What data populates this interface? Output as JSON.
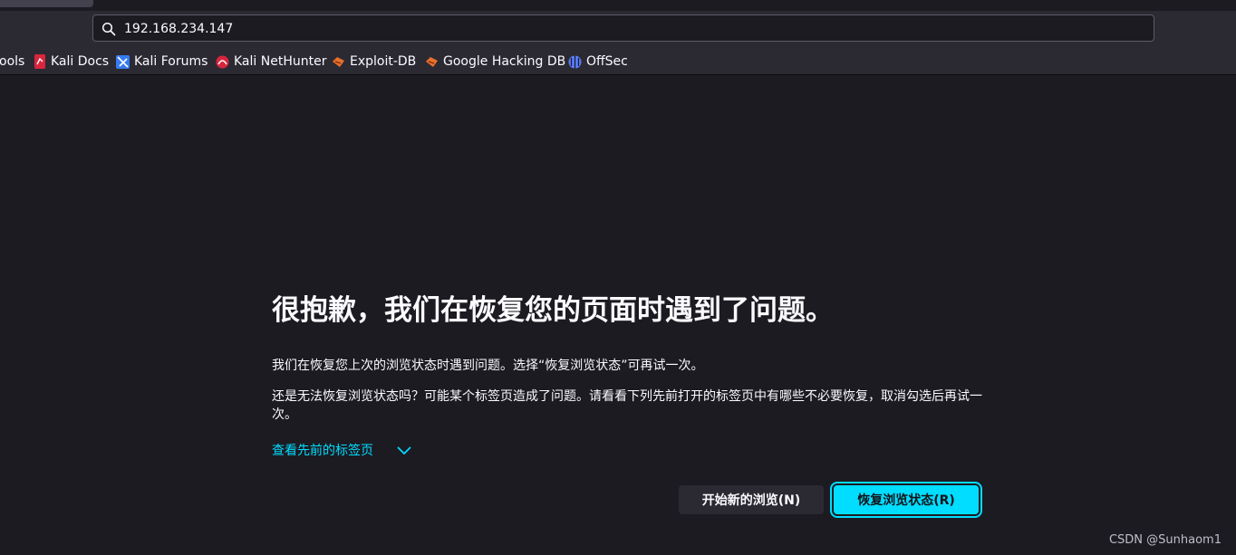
{
  "toolbar": {
    "url": "192.168.234.147"
  },
  "bookmarks": [
    {
      "label": "ools",
      "icon": "truncated-bookmark"
    },
    {
      "label": "Kali Docs",
      "icon": "kali-docs-icon",
      "color": "#d7263d"
    },
    {
      "label": "Kali Forums",
      "icon": "kali-forums-icon",
      "color": "#367bf0"
    },
    {
      "label": "Kali NetHunter",
      "icon": "kali-nethunter-icon",
      "color": "#d7263d"
    },
    {
      "label": "Exploit-DB",
      "icon": "exploit-db-icon",
      "color": "#e86f2c"
    },
    {
      "label": "Google Hacking DB",
      "icon": "ghdb-icon",
      "color": "#e86f2c"
    },
    {
      "label": "OffSec",
      "icon": "offsec-icon",
      "color": "#5b7fff"
    }
  ],
  "page": {
    "title": "很抱歉，我们在恢复您的页面时遇到了问题。",
    "message1": "我们在恢复您上次的浏览状态时遇到问题。选择“恢复浏览状态”可再试一次。",
    "message2": "还是无法恢复浏览状态吗？可能某个标签页造成了问题。请看看下列先前打开的标签页中有哪些不必要恢复，取消勾选后再试一次。",
    "toggle_label": "查看先前的标签页",
    "new_session_label": "开始新的浏览(N)",
    "restore_label": "恢复浏览状态(R)"
  },
  "watermark": "CSDN @Sunhaom1",
  "colors": {
    "background": "#1c1b22",
    "toolbar": "#2b2a33",
    "accent": "#00ddff"
  }
}
